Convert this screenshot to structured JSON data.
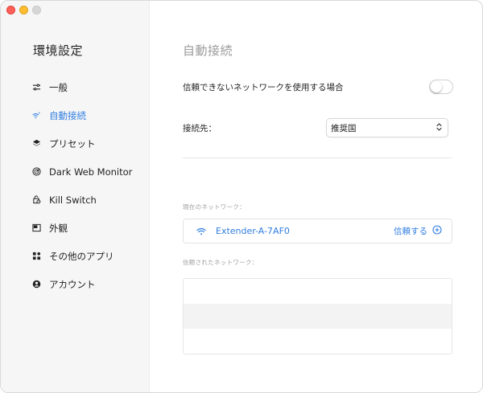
{
  "window": {
    "traffic_lights": [
      "close",
      "minimize",
      "maximize"
    ],
    "colors": {
      "close": "#fe5f57",
      "minimize": "#febc2e",
      "maximize": "#d6d6d6"
    }
  },
  "sidebar": {
    "title": "環境設定",
    "items": [
      {
        "label": "一般",
        "icon": "sliders-icon",
        "active": false
      },
      {
        "label": "自動接続",
        "icon": "wifi-auto-icon",
        "active": true
      },
      {
        "label": "プリセット",
        "icon": "layers-icon",
        "active": false
      },
      {
        "label": "Dark Web Monitor",
        "icon": "radar-icon",
        "active": false
      },
      {
        "label": "Kill Switch",
        "icon": "kill-switch-icon",
        "active": false
      },
      {
        "label": "外観",
        "icon": "appearance-icon",
        "active": false
      },
      {
        "label": "その他のアプリ",
        "icon": "apps-grid-icon",
        "active": false
      },
      {
        "label": "アカウント",
        "icon": "account-icon",
        "active": false
      }
    ]
  },
  "main": {
    "title": "自動接続",
    "untrusted": {
      "label": "信頼できないネットワークを使用する場合",
      "enabled": false
    },
    "destination": {
      "label": "接続先：",
      "selected": "推奨国"
    },
    "current_network": {
      "label": "現在のネットワーク：",
      "name": "Extender-A-7AF0",
      "trust_label": "信頼する"
    },
    "trusted_networks": {
      "label": "信頼されたネットワーク：",
      "rows": [
        "",
        "",
        ""
      ]
    }
  },
  "colors": {
    "accent": "#2f7de1",
    "sidebar_bg": "#f6f6f6",
    "muted_text": "#9a9a9a"
  }
}
